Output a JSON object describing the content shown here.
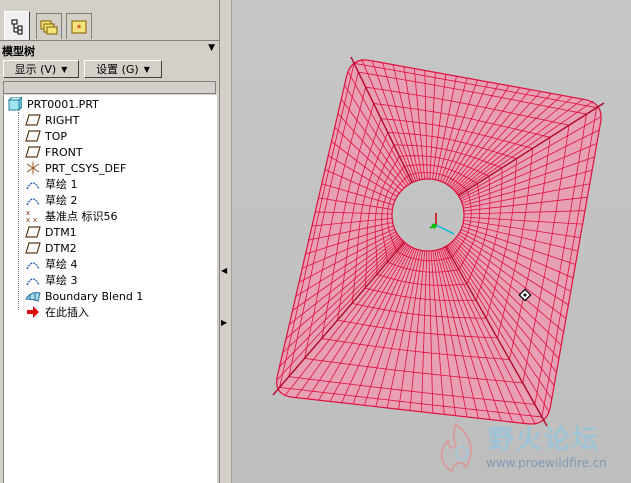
{
  "navigator": {
    "tabs": [
      {
        "icon": "model-tree-tab-icon",
        "active": true
      },
      {
        "icon": "folder-browser-tab-icon",
        "active": false
      },
      {
        "icon": "favorites-tab-icon",
        "active": false
      }
    ],
    "title": "模型树",
    "toolbar": {
      "show_label": "显示 (V)",
      "settings_label": "设置 (G)"
    },
    "tree": [
      {
        "label": "PRT0001.PRT",
        "icon": "part-icon"
      },
      {
        "label": "RIGHT",
        "icon": "datum-plane-icon"
      },
      {
        "label": "TOP",
        "icon": "datum-plane-icon"
      },
      {
        "label": "FRONT",
        "icon": "datum-plane-icon"
      },
      {
        "label": "PRT_CSYS_DEF",
        "icon": "coordinate-system-icon"
      },
      {
        "label": "草绘 1",
        "icon": "sketch-icon"
      },
      {
        "label": "草绘 2",
        "icon": "sketch-icon"
      },
      {
        "label": "基准点 标识56",
        "icon": "datum-point-icon"
      },
      {
        "label": "DTM1",
        "icon": "datum-plane-icon"
      },
      {
        "label": "DTM2",
        "icon": "datum-plane-icon"
      },
      {
        "label": "草绘 4",
        "icon": "sketch-icon"
      },
      {
        "label": "草绘 3",
        "icon": "sketch-icon"
      },
      {
        "label": "Boundary Blend 1",
        "icon": "boundary-blend-icon"
      },
      {
        "label": "在此插入",
        "icon": "insert-here-arrow-icon"
      }
    ]
  },
  "watermark": {
    "title": "野火论坛",
    "url": "www.proewildfire.cn"
  },
  "colors": {
    "surface_fill": "#e8a0b4",
    "surface_mesh": "#e0103c",
    "background": "#c4c4c4"
  }
}
